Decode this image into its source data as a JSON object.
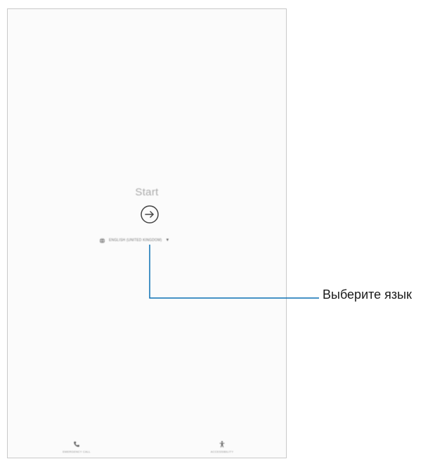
{
  "screen": {
    "title": "Start",
    "start_icon": "arrow-right-circle-icon",
    "language": {
      "icon": "globe-icon",
      "selected_value": "ENGLISH (UNITED KINGDOM)",
      "dropdown_icon": "dropdown-arrow-icon"
    },
    "bottom_actions": {
      "emergency": {
        "icon": "phone-icon",
        "label": "EMERGENCY CALL"
      },
      "accessibility": {
        "icon": "accessibility-icon",
        "label": "ACCESSIBILITY"
      }
    }
  },
  "callout": {
    "text": "Выберите язык",
    "line_color": "#0b6fb3"
  }
}
